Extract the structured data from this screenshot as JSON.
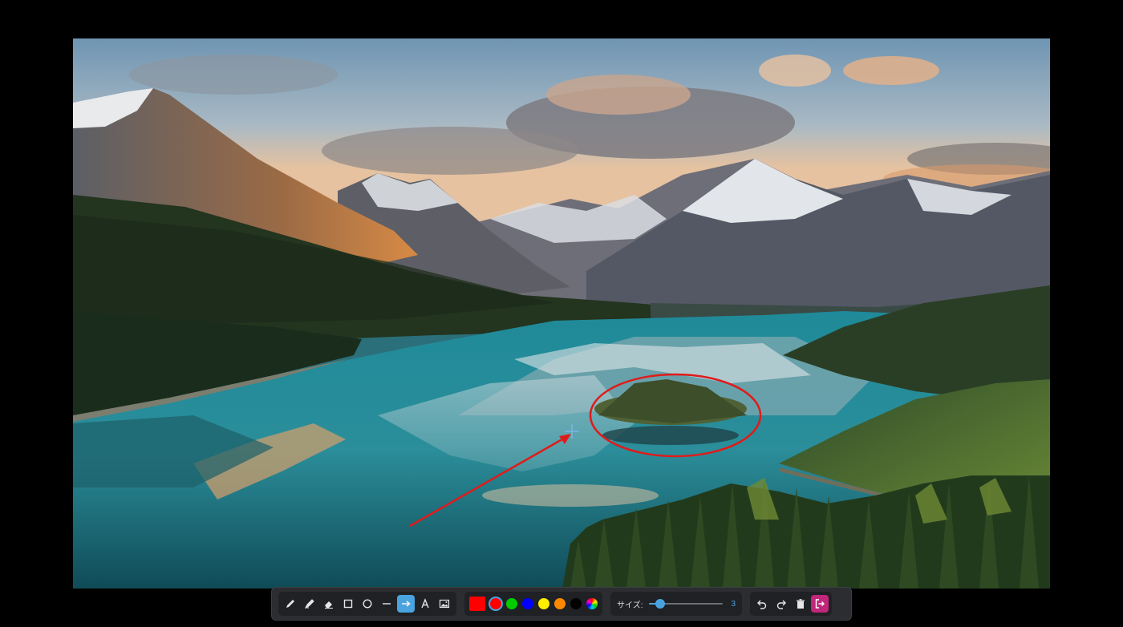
{
  "app": {
    "size_label": "サイズ:",
    "size_value": "3",
    "size_fraction": 0.15
  },
  "tools": [
    {
      "name": "pen-tool",
      "icon": "pen-icon",
      "active": false
    },
    {
      "name": "highlighter-tool",
      "icon": "highlighter-icon",
      "active": false
    },
    {
      "name": "eraser-tool",
      "icon": "eraser-icon",
      "active": false
    },
    {
      "name": "rectangle-tool",
      "icon": "rectangle-icon",
      "active": false
    },
    {
      "name": "circle-tool",
      "icon": "circle-icon",
      "active": false
    },
    {
      "name": "line-tool",
      "icon": "line-icon",
      "active": false
    },
    {
      "name": "arrow-tool",
      "icon": "arrow-icon",
      "active": true
    },
    {
      "name": "text-tool",
      "icon": "text-icon",
      "active": false
    },
    {
      "name": "image-tool",
      "icon": "image-icon",
      "active": false
    }
  ],
  "colors": {
    "selected": "#ff0000",
    "swatches": [
      "#ff0000",
      "#00cc00",
      "#0000ff",
      "#ffee00",
      "#ff8800",
      "#000000"
    ],
    "accent": "#4aa3df",
    "exit": "#c0267a"
  },
  "actions": [
    {
      "name": "undo-button",
      "icon": "undo-icon"
    },
    {
      "name": "redo-button",
      "icon": "redo-icon"
    },
    {
      "name": "clear-button",
      "icon": "trash-icon"
    },
    {
      "name": "exit-button",
      "icon": "exit-icon"
    }
  ],
  "annotations": {
    "stroke_color": "#e01b1b",
    "shapes": [
      "arrow",
      "ellipse"
    ]
  }
}
